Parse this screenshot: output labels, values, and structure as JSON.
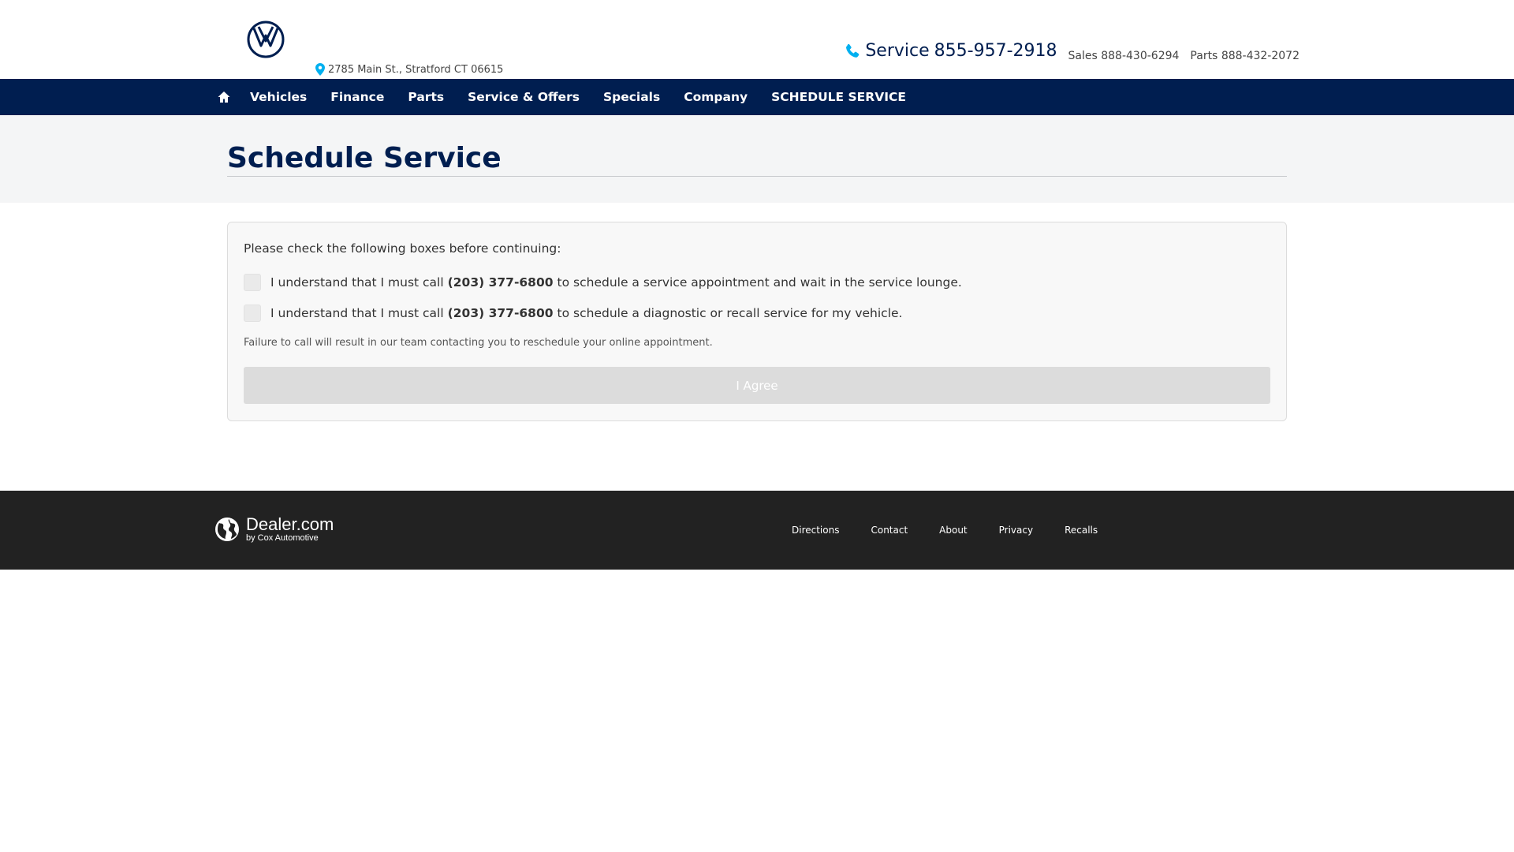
{
  "header": {
    "address": "2785 Main St., Stratford CT 06615",
    "service_label": "Service",
    "service_phone": "855-957-2918",
    "sales_label": "Sales",
    "sales_phone": "888-430-6294",
    "parts_label": "Parts",
    "parts_phone": "888-432-2072",
    "logo_icon": "vw-logo-icon"
  },
  "nav": {
    "home_icon": "home-icon",
    "items": [
      {
        "label": "Vehicles"
      },
      {
        "label": "Finance"
      },
      {
        "label": "Parts"
      },
      {
        "label": "Service & Offers"
      },
      {
        "label": "Specials"
      },
      {
        "label": "Company"
      },
      {
        "label": "SCHEDULE SERVICE"
      }
    ]
  },
  "page": {
    "title": "Schedule Service"
  },
  "card": {
    "intro": "Please check the following boxes before continuing:",
    "checks": [
      {
        "before": "I understand that I must call",
        "phone": "(203) 377-6800",
        "after": "to schedule a service appointment and wait in the service lounge.",
        "checked": false
      },
      {
        "before": "I understand that I must call",
        "phone": "(203) 377-6800",
        "after": "to schedule a diagnostic or recall service for my vehicle.",
        "checked": false
      }
    ],
    "disclaimer": "Failure to call will result in our team contacting you to reschedule your online appointment.",
    "agree_label": "I Agree"
  },
  "footer": {
    "brand_name": "Dealer.com",
    "brand_sub": "by Cox Automotive",
    "links": [
      {
        "label": "Directions"
      },
      {
        "label": "Contact"
      },
      {
        "label": "About"
      },
      {
        "label": "Privacy"
      },
      {
        "label": "Recalls"
      }
    ]
  },
  "colors": {
    "brand_navy": "#001e50",
    "phone_accent": "#00b0f0",
    "footer_bg": "#222222"
  }
}
